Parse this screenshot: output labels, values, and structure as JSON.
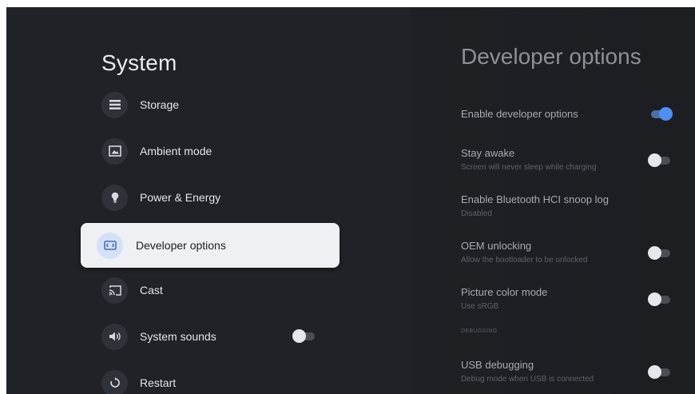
{
  "left": {
    "title": "System",
    "items": [
      {
        "label": "Storage",
        "icon": "storage-icon"
      },
      {
        "label": "Ambient mode",
        "icon": "ambient-icon"
      },
      {
        "label": "Power & Energy",
        "icon": "bulb-icon"
      },
      {
        "label": "Developer options",
        "icon": "developer-icon",
        "selected": true
      },
      {
        "label": "Cast",
        "icon": "cast-icon"
      },
      {
        "label": "System sounds",
        "icon": "speaker-icon",
        "toggle": "off"
      },
      {
        "label": "Restart",
        "icon": "restart-icon"
      }
    ]
  },
  "right": {
    "title": "Developer options",
    "settings": [
      {
        "name": "Enable developer options",
        "sub": "",
        "toggle": "on"
      },
      {
        "name": "Stay awake",
        "sub": "Screen will never sleep while charging",
        "toggle": "off"
      },
      {
        "name": "Enable Bluetooth HCI snoop log",
        "sub": "Disabled",
        "toggle": null
      },
      {
        "name": "OEM unlocking",
        "sub": "Allow the bootloader to be unlocked",
        "toggle": "off"
      },
      {
        "name": "Picture color mode",
        "sub": "Use sRGB",
        "toggle": "off"
      },
      {
        "name": "USB debugging",
        "sub": "Debug mode when USB is connected",
        "toggle": "off"
      }
    ],
    "section_debugging": "DEBUGGING"
  },
  "colors": {
    "background": "#1f2126",
    "selected_bg": "#eef0f4",
    "toggle_on": "#4f8ff5"
  }
}
